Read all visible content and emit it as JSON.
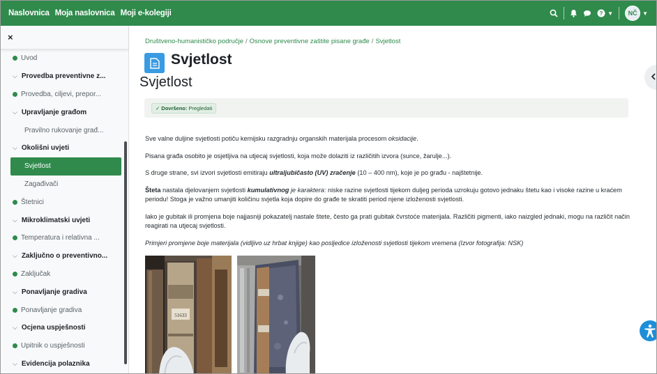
{
  "navbar": {
    "links": [
      "Naslovnica",
      "Moja naslovnica",
      "Moji e-kolegiji"
    ],
    "avatar_initials": "NČ",
    "icons": [
      "search-icon",
      "bell-icon",
      "chat-icon",
      "help-icon",
      "avatar"
    ],
    "color": "#2f8a4c"
  },
  "drawer": {
    "close_label": "×",
    "items": [
      {
        "type": "bullet",
        "label": "Uvod"
      },
      {
        "type": "section",
        "label": "Provedba preventivne z..."
      },
      {
        "type": "bullet",
        "label": "Provedba, ciljevi, prepor..."
      },
      {
        "type": "section",
        "label": "Upravljanje građom"
      },
      {
        "type": "sub",
        "label": "Pravilno rukovanje građ..."
      },
      {
        "type": "section",
        "label": "Okolišni uvjeti"
      },
      {
        "type": "active",
        "label": "Svjetlost"
      },
      {
        "type": "sub",
        "label": "Zagađivači"
      },
      {
        "type": "bullet",
        "label": "Štetnici"
      },
      {
        "type": "section",
        "label": "Mikroklimatski uvjeti"
      },
      {
        "type": "bullet",
        "label": "Temperatura i relativna ..."
      },
      {
        "type": "section",
        "label": "Zaključno o preventivno..."
      },
      {
        "type": "bullet",
        "label": "Zaključak"
      },
      {
        "type": "section",
        "label": "Ponavljanje gradiva"
      },
      {
        "type": "bullet",
        "label": "Ponavljanje gradiva"
      },
      {
        "type": "section",
        "label": "Ocjena uspješnosti"
      },
      {
        "type": "bullet",
        "label": "Upitnik o uspješnosti"
      },
      {
        "type": "section",
        "label": "Evidencija polaznika"
      }
    ]
  },
  "breadcrumb": [
    "Društveno-humanističko područje",
    "Osnove preventivne zaštite pisane građe",
    "Svjetlost"
  ],
  "activity": {
    "title": "Svjetlost",
    "heading": "Svjetlost",
    "completion_check": "✓",
    "completion_label": "Dovršeno:",
    "completion_value": "Pregledati"
  },
  "content": {
    "p1_a": "Sve valne duljine svjetlosti potiču kemijsku razgradnju organskih materijala procesom ",
    "p1_b": "oksidacije",
    "p1_c": ".",
    "p2": "Pisana građa osobito je osjetljiva na utjecaj svjetlosti, koja može dolaziti iz različitih izvora (sunce, žarulje...).",
    "p3_a": "S druge strane, svi izvori svjetlosti emitiraju ",
    "p3_b": "ultraljubičasto (UV) zračenje",
    "p3_c": " (10 – 400 nm), koje je po građu - najštetnije.",
    "p4_a": "Šteta",
    "p4_b": " nastala djelovanjem svjetlosti ",
    "p4_c": "kumulativnog",
    "p4_d": " je karaktera",
    "p4_e": ": niske razine svjetlosti tijekom duljeg perioda uzrokuju gotovo jednaku štetu kao i visoke razine u kraćem periodu! Stoga je važno umanjiti količinu svjetla koja dopire do građe te skratiti period njene izloženosti svjetlosti.",
    "p5": "Iako je gubitak ili promjena boje najjasniji pokazatelj nastale štete, često ga prati gubitak čvrstoće materijala. Različiti pigmenti, iako naizgled jednaki, mogu na različit način reagirati na utjecaj svjetlosti.",
    "p6": "Primjeri promjene boje materijala (vidljivo uz hrbat knjige) kao posljedice izloženosti svjetlosti tijekom vremena (Izvor fotografija: NSK)"
  }
}
